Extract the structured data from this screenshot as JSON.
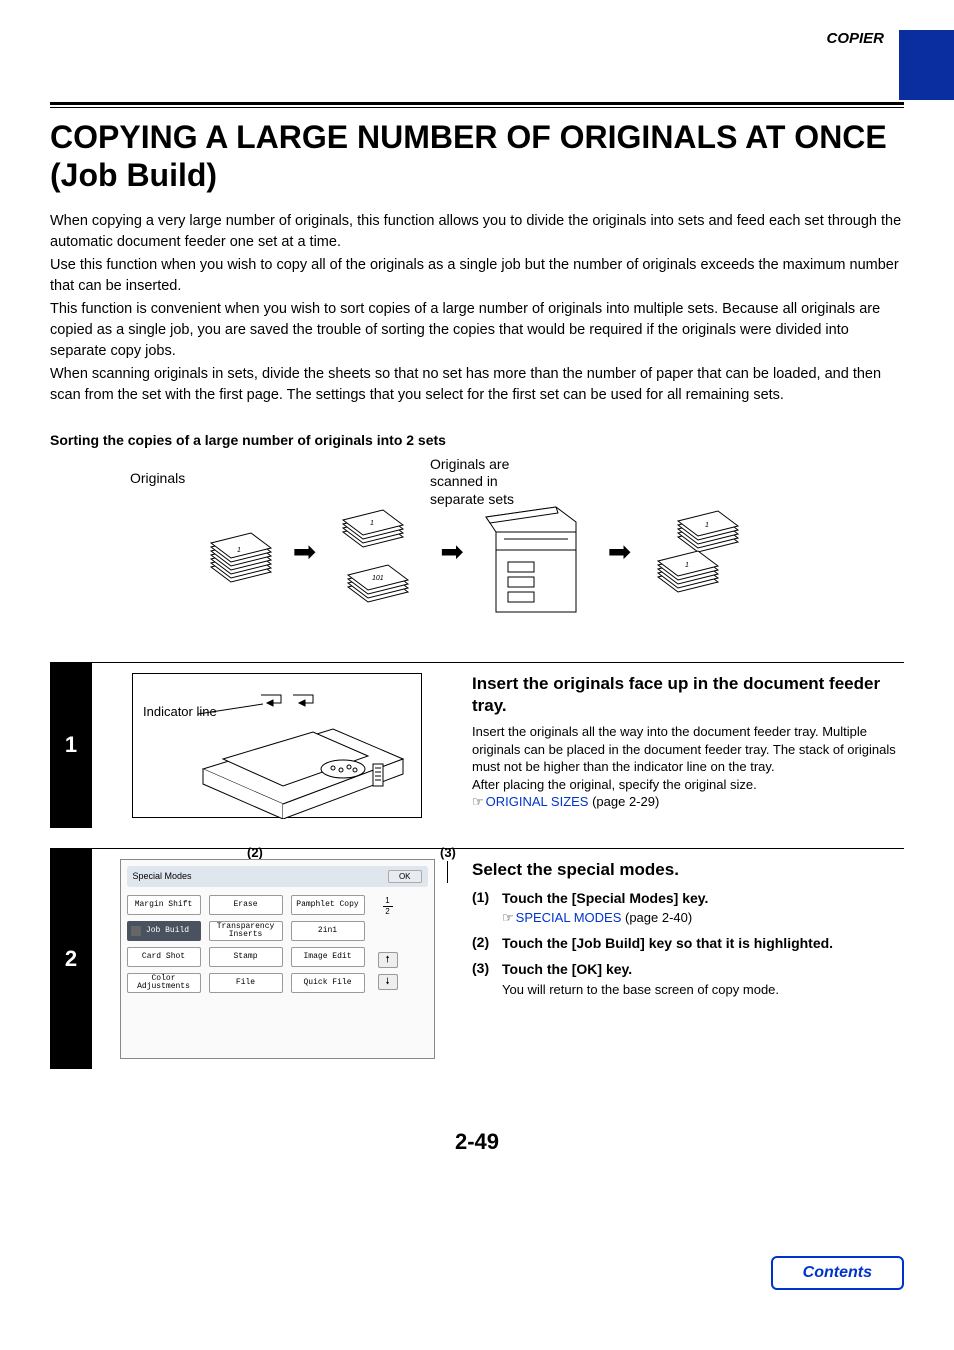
{
  "header": {
    "section": "COPIER"
  },
  "title": "COPYING A LARGE NUMBER OF ORIGINALS AT ONCE (Job Build)",
  "intro": {
    "p1": "When copying a very large number of originals, this function allows you to divide the originals into sets and feed each set through the automatic document feeder one set at a time.",
    "p2": "Use this function when you wish to copy all of the originals as a single job but the number of originals exceeds the maximum number that can be inserted.",
    "p3": "This function is convenient when you wish to sort copies of a large number of originals into multiple sets. Because all originals are copied as a single job, you are saved the trouble of sorting the copies that would be required if the originals were divided into separate copy jobs.",
    "p4": "When scanning originals in sets, divide the sheets so that no set has more than the number of paper that can be loaded, and then scan from the set with the first page. The settings that you select for the first set can be used for all remaining sets."
  },
  "diagram_heading": "Sorting the copies of a large number of originals into 2 sets",
  "diagram_labels": {
    "originals": "Originals",
    "scanned": "Originals are scanned in separate sets",
    "num1": "1",
    "num101": "101"
  },
  "steps": {
    "s1": {
      "badge": "1",
      "indicator_label": "Indicator line",
      "title": "Insert the originals face up in the document feeder tray.",
      "desc1": "Insert the originals all the way into the document feeder tray. Multiple originals can be placed in the document feeder tray. The stack of originals must not be higher than the indicator line on the tray.",
      "desc2": "After placing the original, specify the original size.",
      "link": "ORIGINAL SIZES",
      "link_page": " (page 2-29)"
    },
    "s2": {
      "badge": "2",
      "callouts": {
        "c2": "(2)",
        "c3": "(3)"
      },
      "panel": {
        "header": "Special Modes",
        "ok": "OK",
        "buttons": {
          "margin_shift": "Margin Shift",
          "erase": "Erase",
          "pamphlet": "Pamphlet Copy",
          "job_build": "Job Build",
          "transparency": "Transparency Inserts",
          "twoin1": "2in1",
          "card_shot": "Card Shot",
          "stamp": "Stamp",
          "image_edit": "Image Edit",
          "color_adj": "Color Adjustments",
          "file": "File",
          "quick_file": "Quick File"
        },
        "page_frac_top": "1",
        "page_frac_bot": "2"
      },
      "title": "Select the special modes.",
      "items": [
        {
          "num": "(1)",
          "main": "Touch the [Special Modes] key.",
          "link": "SPECIAL MODES",
          "link_page": " (page 2-40)"
        },
        {
          "num": "(2)",
          "main": "Touch the [Job Build] key so that it is highlighted."
        },
        {
          "num": "(3)",
          "main": "Touch the [OK] key.",
          "note": "You will return to the base screen of copy mode."
        }
      ]
    }
  },
  "page_number": "2-49",
  "contents_button": "Contents"
}
